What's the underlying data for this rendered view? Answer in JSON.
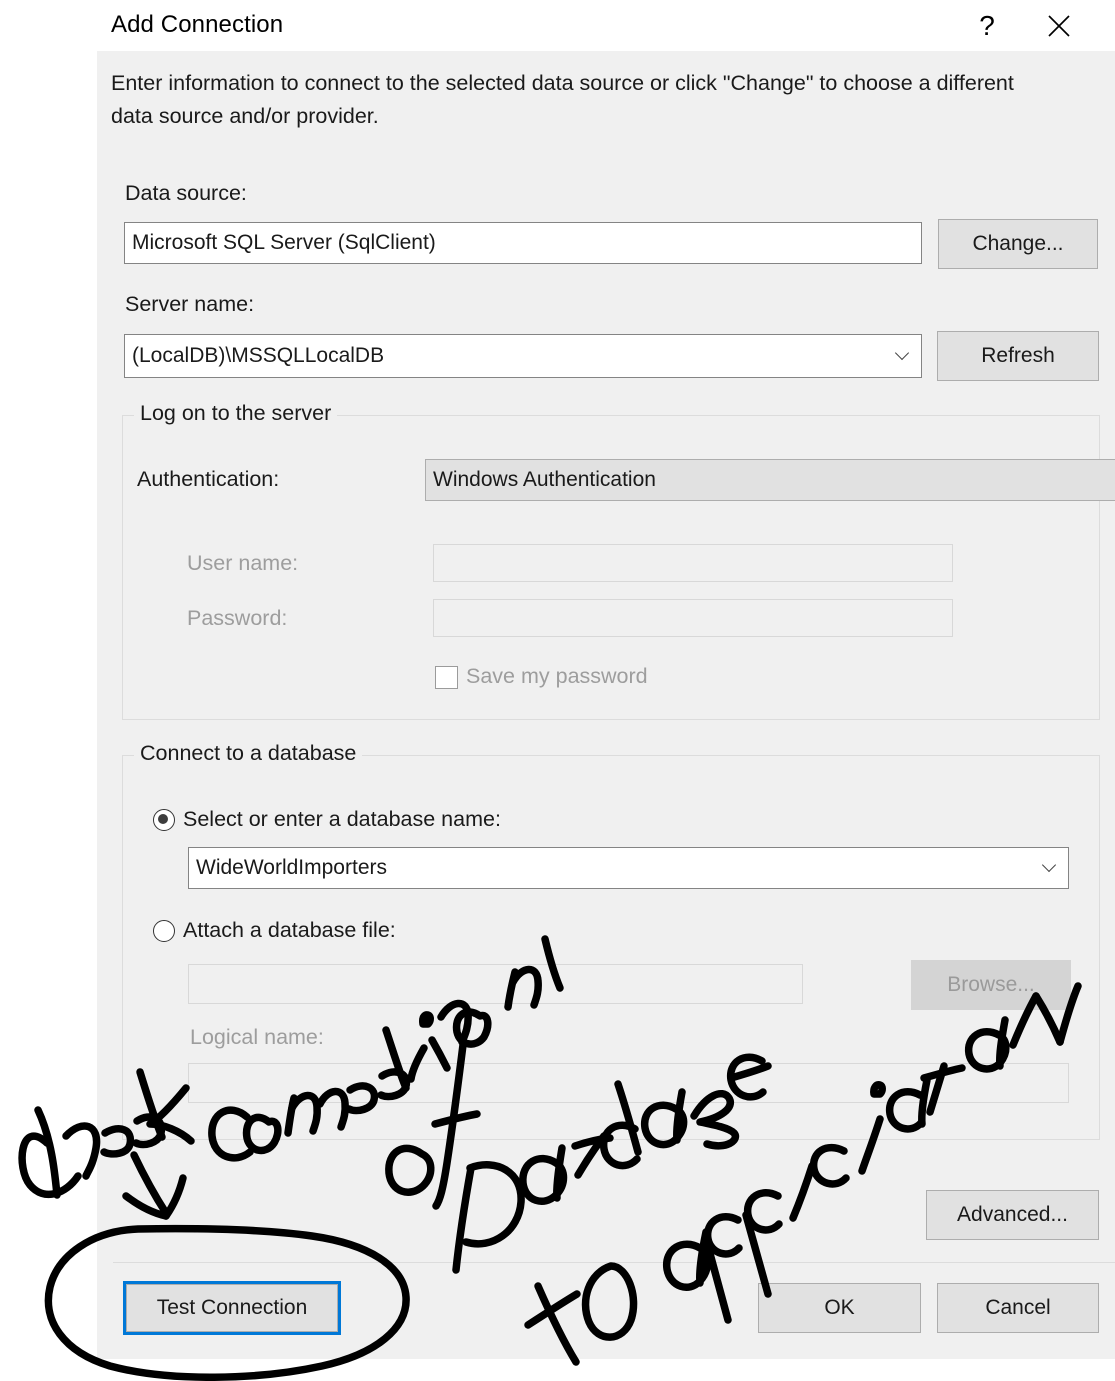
{
  "window": {
    "title": "Add Connection",
    "help_icon": "question-mark-icon",
    "close_icon": "close-icon",
    "help_label": "?",
    "close_label": "✕"
  },
  "intro_text": "Enter information to connect to the selected data source or click \"Change\" to choose a different data source and/or provider.",
  "data_source": {
    "label": "Data source:",
    "value": "Microsoft SQL Server (SqlClient)",
    "change_button": "Change..."
  },
  "server": {
    "label": "Server name:",
    "value": "(LocalDB)\\MSSQLLocalDB",
    "refresh_button": "Refresh"
  },
  "logon_group": {
    "title": "Log on to the server",
    "authentication_label": "Authentication:",
    "authentication_value": "Windows Authentication",
    "username_label": "User name:",
    "username_value": "",
    "password_label": "Password:",
    "password_value": "",
    "save_password_label": "Save my password",
    "save_password_checked": false
  },
  "database_group": {
    "title": "Connect to a database",
    "select_radio_label": "Select or enter a database name:",
    "select_radio_checked": true,
    "database_value": "WideWorldImporters",
    "attach_radio_label": "Attach a database file:",
    "attach_radio_checked": false,
    "attach_file_value": "",
    "browse_button": "Browse...",
    "logical_name_label": "Logical name:",
    "logical_name_value": ""
  },
  "footer": {
    "advanced_button": "Advanced...",
    "test_connection_button": "Test Connection",
    "ok_button": "OK",
    "cancel_button": "Cancel"
  },
  "annotations": {
    "ink_color": "#000000",
    "text": "Check Connection of Database to application",
    "words": [
      "Check",
      "Connection",
      "of",
      "Database",
      "to",
      "application"
    ],
    "marks": [
      "down-arrow pointing at Test Connection",
      "ellipse circling Test Connection button"
    ]
  },
  "colors": {
    "dialog_background": "#f0f0f0",
    "titlebar_background": "#ffffff",
    "focus_accent": "#0078d7",
    "button_face": "#e1e1e1",
    "input_background": "#ffffff",
    "disabled_text": "#a0a0a0"
  }
}
